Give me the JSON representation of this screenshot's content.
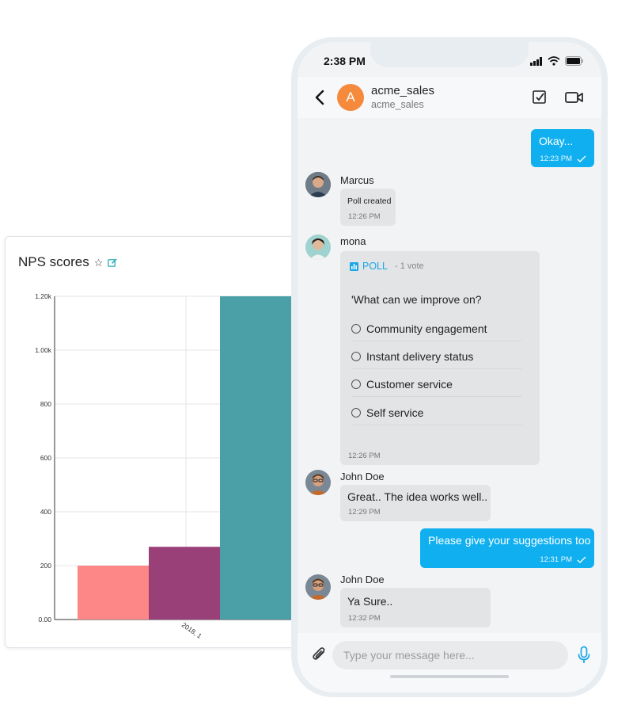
{
  "chart_card": {
    "title": "NPS scores"
  },
  "chart_data": {
    "type": "bar",
    "title": "NPS scores",
    "categories": [
      "2018, 1"
    ],
    "series": [
      {
        "values": [
          200
        ],
        "color": "#fd8687"
      },
      {
        "values": [
          270
        ],
        "color": "#9a4078"
      },
      {
        "values": [
          1200
        ],
        "color": "#4b9fa6"
      }
    ],
    "ylim": [
      0,
      1200
    ],
    "yticks": [
      {
        "value": 0,
        "label": "0.00"
      },
      {
        "value": 200,
        "label": "200"
      },
      {
        "value": 400,
        "label": "400"
      },
      {
        "value": 600,
        "label": "600"
      },
      {
        "value": 800,
        "label": "800"
      },
      {
        "value": 1000,
        "label": "1.00k"
      },
      {
        "value": 1200,
        "label": "1.20k"
      }
    ],
    "grid": true
  },
  "status_bar": {
    "time": "2:38 PM"
  },
  "header": {
    "avatar_letter": "A",
    "name": "acme_sales",
    "subtitle": "acme_sales"
  },
  "messages": {
    "m1": {
      "text": "Okay...",
      "time": "12:23 PM"
    },
    "m2": {
      "sender": "Marcus",
      "text": "Poll created",
      "time": "12:26 PM"
    },
    "m3": {
      "sender": "mona",
      "poll_label": "POLL",
      "poll_votes": "- 1 vote",
      "question": "'What can we improve on?",
      "options": [
        "Community engagement",
        "Instant delivery status",
        "Customer service",
        "Self service"
      ],
      "time": "12:26 PM"
    },
    "m4": {
      "sender": "John Doe",
      "text": "Great.. The idea works well..",
      "time": "12:29 PM"
    },
    "m5": {
      "text": "Please give your suggestions too",
      "time": "12:31 PM"
    },
    "m6": {
      "sender": "John Doe",
      "text": "Ya Sure..",
      "time": "12:32 PM"
    }
  },
  "composer": {
    "placeholder": "Type your message here..."
  },
  "colors": {
    "accent": "#10b0f0",
    "avatar_bg": "#f58a3c",
    "poll_accent": "#1aa6e8"
  }
}
